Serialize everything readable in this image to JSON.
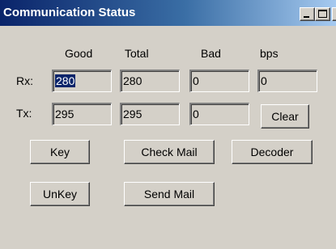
{
  "window": {
    "title": "Communication Status",
    "controls": {
      "minimize_icon": "minimize-icon",
      "maximize_icon": "maximize-icon",
      "close_glyph": "✕"
    }
  },
  "columns": {
    "good": "Good",
    "total": "Total",
    "bad": "Bad",
    "bps": "bps"
  },
  "rows": {
    "rx": {
      "label": "Rx:",
      "good": "280",
      "total": "280",
      "bad": "0",
      "bps": "0"
    },
    "tx": {
      "label": "Tx:",
      "good": "295",
      "total": "295",
      "bad": "0"
    }
  },
  "buttons": {
    "clear": "Clear",
    "key": "Key",
    "check_mail": "Check Mail",
    "decoder": "Decoder",
    "unkey": "UnKey",
    "send_mail": "Send Mail"
  },
  "colors": {
    "titlebar_start": "#0a246a",
    "titlebar_end": "#a6caf0",
    "face": "#d4d0c8",
    "selection": "#0a246a"
  }
}
